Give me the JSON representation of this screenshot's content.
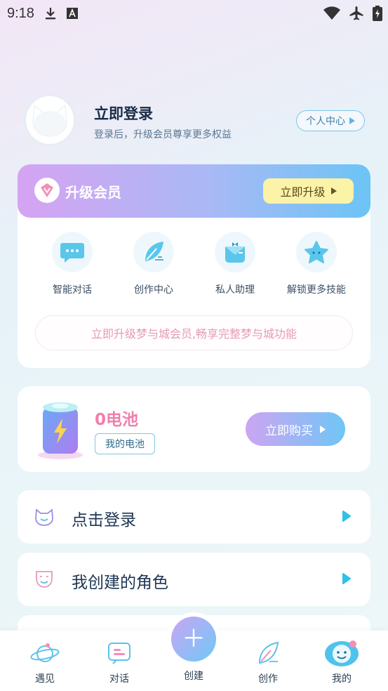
{
  "status_bar": {
    "time": "9:18"
  },
  "profile": {
    "name": "立即登录",
    "subtitle": "登录后，升级会员尊享更多权益",
    "center_button": "个人中心"
  },
  "member": {
    "title": "升级会员",
    "upgrade_button": "立即升级",
    "features": [
      {
        "label": "智能对话",
        "icon": "chat-icon"
      },
      {
        "label": "创作中心",
        "icon": "leaf-pen-icon"
      },
      {
        "label": "私人助理",
        "icon": "butler-icon"
      },
      {
        "label": "解锁更多技能",
        "icon": "star-icon"
      }
    ],
    "promo_text": "立即升级梦与城会员,畅享完整梦与城功能"
  },
  "battery": {
    "count_label": "0电池",
    "my_battery_button": "我的电池",
    "buy_button": "立即购买"
  },
  "rows": [
    {
      "label": "点击登录",
      "icon": "cat-face-icon"
    },
    {
      "label": "我创建的角色",
      "icon": "mask-icon"
    }
  ],
  "bottom_nav": {
    "items": [
      {
        "label": "遇见",
        "icon": "planet-icon"
      },
      {
        "label": "对话",
        "icon": "message-icon"
      },
      {
        "label": "创建",
        "icon": "plus-icon"
      },
      {
        "label": "创作",
        "icon": "leaf-icon"
      },
      {
        "label": "我的",
        "icon": "smiley-icon"
      }
    ]
  },
  "colors": {
    "accent_blue": "#6cc4f5",
    "accent_purple": "#d6a3f2",
    "pink_text": "#f07fad",
    "upgrade_yellow": "#fbf3a8"
  }
}
